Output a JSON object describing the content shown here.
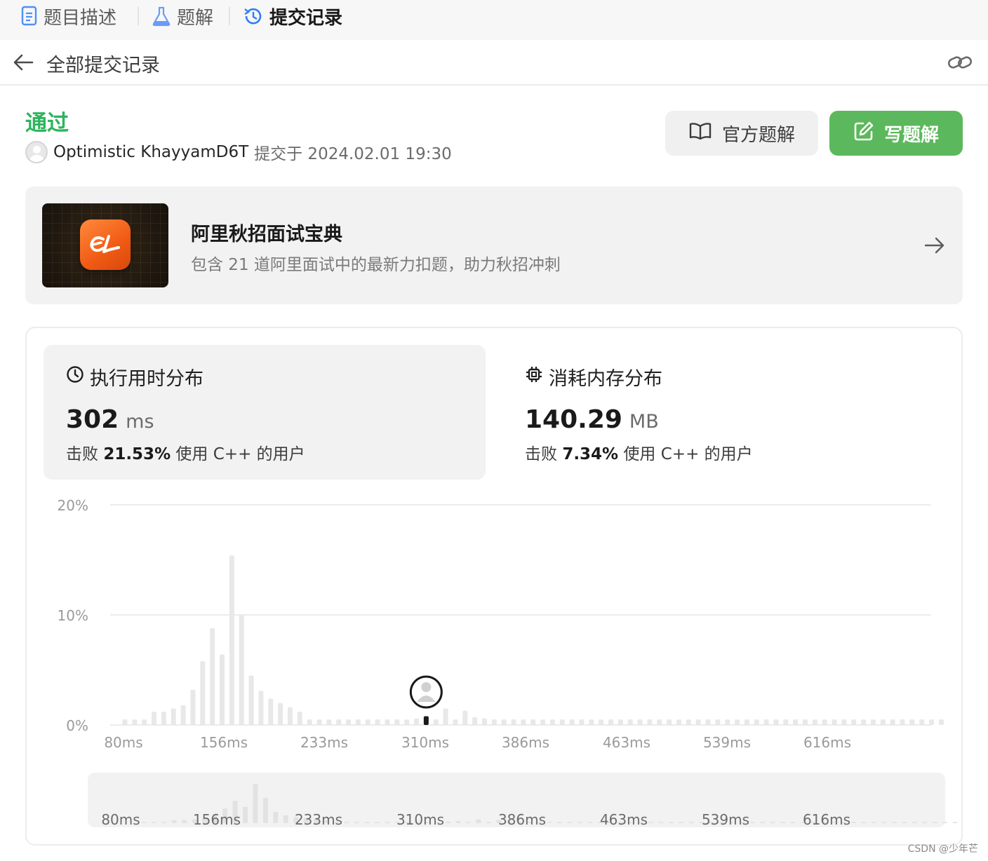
{
  "tabs": [
    {
      "label": "题目描述",
      "icon": "document-icon"
    },
    {
      "label": "题解",
      "icon": "flask-icon"
    },
    {
      "label": "提交记录",
      "icon": "history-icon",
      "active": true
    }
  ],
  "subheader": {
    "title": "全部提交记录"
  },
  "submission": {
    "status": "通过",
    "user": "Optimistic KhayyamD6T",
    "submitted": "提交于 2024.02.01 19:30"
  },
  "actions": {
    "official_label": "官方题解",
    "write_label": "写题解"
  },
  "promo": {
    "title": "阿里秋招面试宝典",
    "description": "包含 21 道阿里面试中的最新力扣题，助力秋招冲刺"
  },
  "stats": {
    "runtime": {
      "title": "执行用时分布",
      "value": "302",
      "unit": "ms",
      "beat_prefix": "击败",
      "beat": "21.53%",
      "beat_suffix": "使用 C++ 的用户"
    },
    "memory": {
      "title": "消耗内存分布",
      "value": "140.29",
      "unit": "MB",
      "beat_prefix": "击败",
      "beat": "7.34%",
      "beat_suffix": "使用 C++ 的用户"
    }
  },
  "chart_data": {
    "type": "bar",
    "y_ticks": [
      "20%",
      "10%",
      "0%"
    ],
    "ylim": [
      0,
      20
    ],
    "x_ticks": [
      "80ms",
      "156ms",
      "233ms",
      "310ms",
      "386ms",
      "463ms",
      "539ms",
      "616ms"
    ],
    "values": [
      0.5,
      0.5,
      0.5,
      1.2,
      1.2,
      1.5,
      1.8,
      3.2,
      5.8,
      8.8,
      6.4,
      15.4,
      10.0,
      4.5,
      3.1,
      2.4,
      2.0,
      1.6,
      1.2,
      0.5,
      0.5,
      0.5,
      0.5,
      0.5,
      0.5,
      0.5,
      0.5,
      0.5,
      0.5,
      0.5,
      0.6,
      0.8,
      0.5,
      1.5,
      0.5,
      1.3,
      0.7,
      0.6,
      0.5,
      0.5,
      0.5,
      0.5,
      0.5,
      0.5,
      0.5,
      0.5,
      0.5,
      0.5,
      0.5,
      0.5,
      0.5,
      0.5,
      0.5,
      0.5,
      0.5,
      0.5,
      0.5,
      0.5,
      0.5,
      0.5,
      0.5,
      0.5,
      0.5,
      0.5,
      0.5,
      0.5,
      0.5,
      0.5,
      0.5,
      0.5,
      0.5,
      0.5,
      0.5,
      0.5,
      0.5,
      0.5,
      0.5,
      0.5,
      0.5,
      0.5,
      0.5,
      0.5,
      0.5,
      0.5,
      0.5
    ],
    "highlight_index": 31,
    "grid": true,
    "colors": {
      "bar": "#e8e8e8",
      "highlight": "#1a1a1a",
      "grid": "#e5e5e5",
      "brush_bg": "#f2f2f3"
    }
  },
  "watermark": "CSDN @少年芒"
}
